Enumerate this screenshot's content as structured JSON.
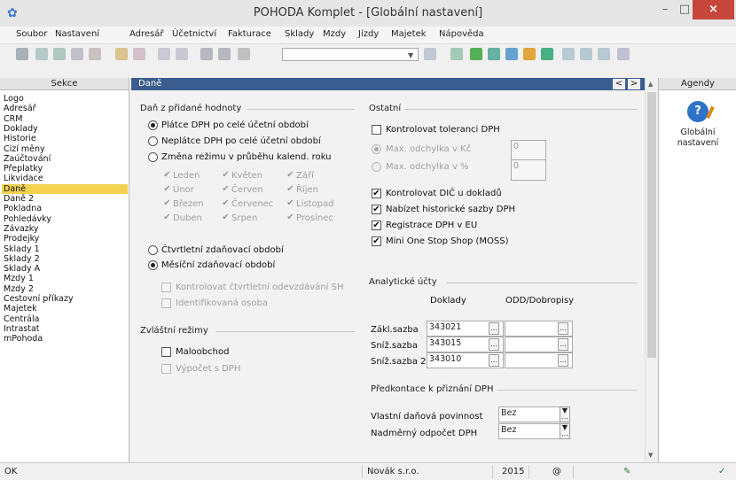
{
  "window": {
    "title": "POHODA Komplet - [Globální nastavení]",
    "min": "–",
    "max": "□",
    "close": "×"
  },
  "menu": [
    "Soubor",
    "Nastavení",
    "Adresář",
    "Účetnictví",
    "Fakturace",
    "Sklady",
    "Mzdy",
    "Jízdy",
    "Majetek",
    "Nápověda"
  ],
  "sekce": {
    "header": "Sekce",
    "items": [
      "Logo",
      "Adresář",
      "CRM",
      "Doklady",
      "Historie",
      "Cizí měny",
      "Zaúčtování",
      "Přeplatky",
      "Likvidace",
      "Daně",
      "Daně 2",
      "Pokladna",
      "Pohledávky",
      "Závazky",
      "Prodejky",
      "Sklady 1",
      "Sklady 2",
      "Sklady A",
      "Mzdy 1",
      "Mzdy 2",
      "Cestovní příkazy",
      "Majetek",
      "Centrála",
      "Intrastat",
      "mPohoda"
    ],
    "selected": "Daně"
  },
  "main": {
    "header": "Daně",
    "prev": "<",
    "next": ">"
  },
  "dph": {
    "title": "Daň z přidané hodnoty",
    "platce": "Plátce DPH po celé účetní období",
    "neplatce": "Neplátce DPH po celé účetní období",
    "zmena": "Změna režimu v průběhu kalend. roku",
    "months": [
      "Leden",
      "Únor",
      "Březen",
      "Duben",
      "Květen",
      "Červen",
      "Červenec",
      "Srpen",
      "Září",
      "Říjen",
      "Listopad",
      "Prosinec"
    ],
    "ctvrtletni": "Čtvrtletní zdaňovací období",
    "mesicni": "Měsíční zdaňovací období",
    "kontrolovat_sh": "Kontrolovat čtvrtletní odevzdávání SH",
    "identifikovana": "Identifikovaná osoba"
  },
  "zvlastni": {
    "title": "Zvláštní režimy",
    "maloobchod": "Maloobchod",
    "vypocet": "Výpočet s DPH"
  },
  "ostatni": {
    "title": "Ostatní",
    "tolerance": "Kontrolovat toleranci DPH",
    "max_kc": "Max. odchylka v Kč",
    "max_kc_val": "0",
    "max_pct": "Max. odchylka v %",
    "max_pct_val": "0",
    "dic": "Kontrolovat DIČ u dokladů",
    "historicke": "Nabízet historické sazby DPH",
    "registrace": "Registrace DPH v EU",
    "moss": "Mini One Stop Shop (MOSS)"
  },
  "analyticke": {
    "title": "Analytické účty",
    "col_doklady": "Doklady",
    "col_odd": "ODD/Dobropisy",
    "rows": [
      {
        "label": "Zákl.sazba",
        "value": "343021"
      },
      {
        "label": "Sníž.sazba",
        "value": "343015"
      },
      {
        "label": "Sníž.sazba 2",
        "value": "343010"
      }
    ],
    "dots": "..."
  },
  "predkontace": {
    "title": "Předkontace k přiznání DPH",
    "rows": [
      {
        "label": "Vlastní daňová povinnost",
        "value": "Bez"
      },
      {
        "label": "Nadměrný odpočet DPH",
        "value": "Bez"
      }
    ]
  },
  "agendy": {
    "header": "Agendy",
    "label1": "Globální",
    "label2": "nastavení"
  },
  "status": {
    "left": "OK",
    "company": "Novák s.r.o.",
    "year": "2015",
    "at": "@",
    "check": "✓"
  },
  "colors": {
    "accent": "#3b5c8e",
    "selection": "#f2d24f",
    "close": "#c7463c"
  }
}
